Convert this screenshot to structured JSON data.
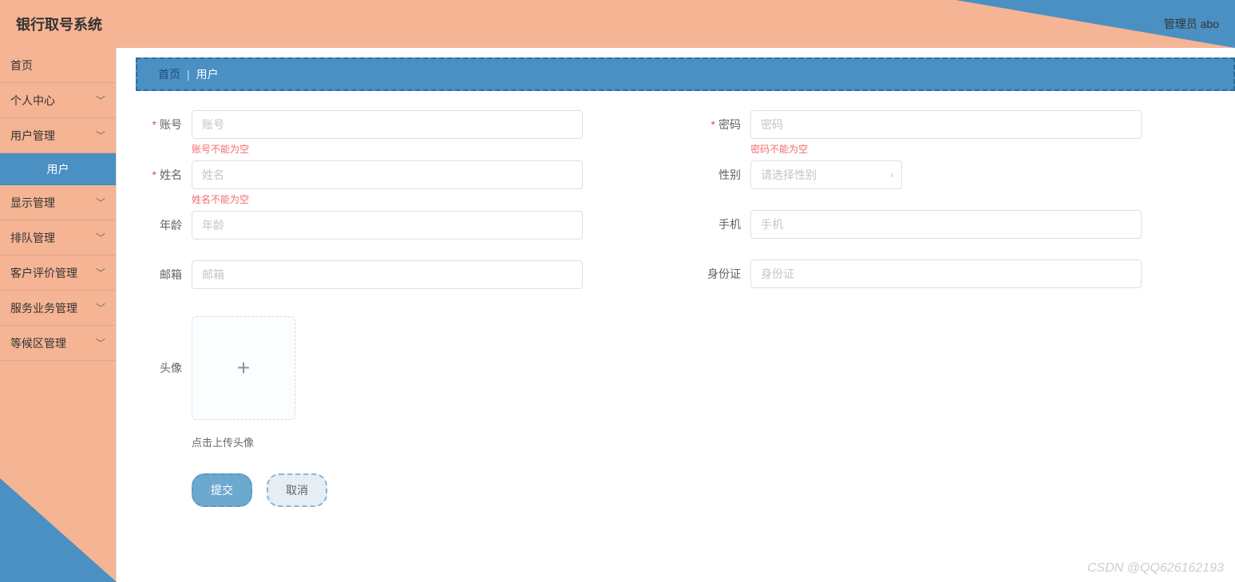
{
  "header": {
    "title": "银行取号系统",
    "user_label": "管理员 abo"
  },
  "sidebar": {
    "items": [
      {
        "label": "首页",
        "type": "plain"
      },
      {
        "label": "个人中心",
        "type": "expand"
      },
      {
        "label": "用户管理",
        "type": "expand"
      },
      {
        "label": "用户",
        "type": "sub"
      },
      {
        "label": "显示管理",
        "type": "expand"
      },
      {
        "label": "排队管理",
        "type": "expand"
      },
      {
        "label": "客户评价管理",
        "type": "expand"
      },
      {
        "label": "服务业务管理",
        "type": "expand"
      },
      {
        "label": "等候区管理",
        "type": "expand"
      }
    ]
  },
  "breadcrumb": {
    "home": "首页",
    "current": "用户"
  },
  "form": {
    "account_label": "账号",
    "account_placeholder": "账号",
    "account_error": "账号不能为空",
    "name_label": "姓名",
    "name_placeholder": "姓名",
    "name_error": "姓名不能为空",
    "age_label": "年龄",
    "age_placeholder": "年龄",
    "email_label": "邮箱",
    "email_placeholder": "邮箱",
    "avatar_label": "头像",
    "upload_hint": "点击上传头像",
    "password_label": "密码",
    "password_placeholder": "密码",
    "password_error": "密码不能为空",
    "gender_label": "性别",
    "gender_placeholder": "请选择性别",
    "phone_label": "手机",
    "phone_placeholder": "手机",
    "idcard_label": "身份证",
    "idcard_placeholder": "身份证"
  },
  "buttons": {
    "submit": "提交",
    "cancel": "取消"
  },
  "watermark": "CSDN @QQ626162193"
}
